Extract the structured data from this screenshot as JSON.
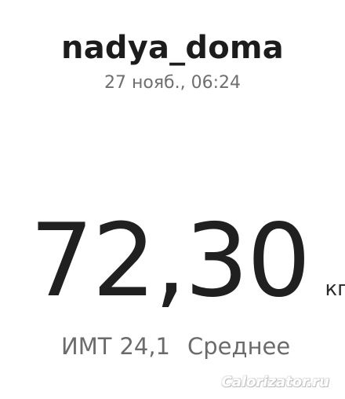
{
  "header": {
    "username": "nadya_doma",
    "datetime": "27 нояб., 06:24"
  },
  "measurement": {
    "weight_value": "72,30",
    "weight_unit": "кг",
    "bmi_label": "ИМТ",
    "bmi_value": "24,1",
    "bmi_category": "Среднее"
  },
  "watermark": {
    "text": "Calorizator.ru"
  }
}
